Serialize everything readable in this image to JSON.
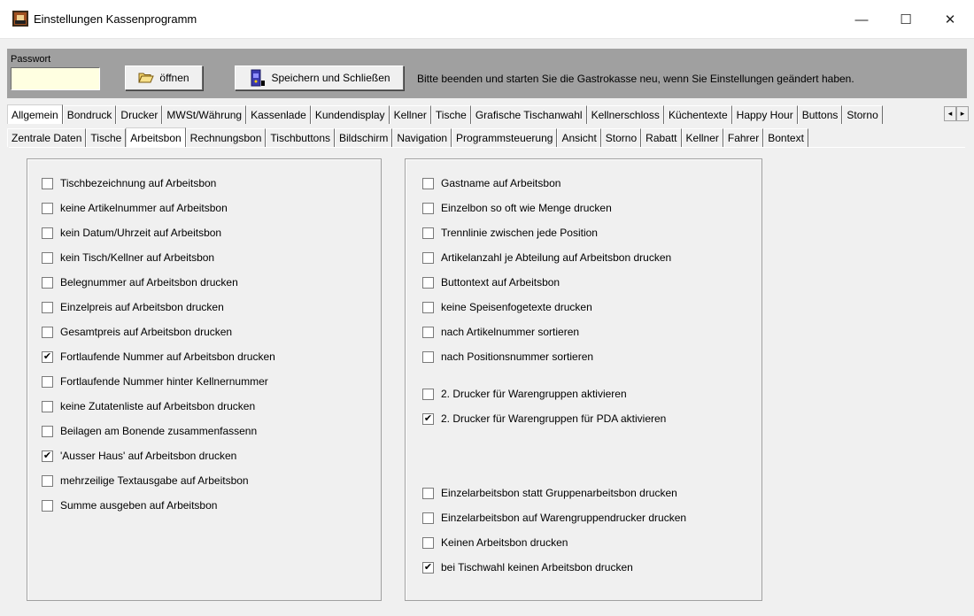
{
  "window": {
    "title": "Einstellungen Kassenprogramm",
    "controls": {
      "minimize": "—",
      "maximize": "☐",
      "close": "✕"
    }
  },
  "toolbar": {
    "password_label": "Passwort",
    "password_value": "",
    "open_label": "öffnen",
    "save_close_label": "Speichern und Schließen",
    "hint": "Bitte beenden und starten Sie die Gastrokasse neu, wenn Sie Einstellungen geändert haben."
  },
  "tabs_row1": [
    "Allgemein",
    "Bondruck",
    "Drucker",
    "MWSt/Währung",
    "Kassenlade",
    "Kundendisplay",
    "Kellner",
    "Tische",
    "Grafische Tischanwahl",
    "Kellnerschloss",
    "Küchentexte",
    "Happy Hour",
    "Buttons",
    "Storno"
  ],
  "tabs_row1_active": "Allgemein",
  "tabs_row2": [
    "Zentrale Daten",
    "Tische",
    "Arbeitsbon",
    "Rechnungsbon",
    "Tischbuttons",
    "Bildschirm",
    "Navigation",
    "Programmsteuerung",
    "Ansicht",
    "Storno",
    "Rabatt",
    "Kellner",
    "Fahrer",
    "Bontext"
  ],
  "tabs_row2_active": "Arbeitsbon",
  "left_options": [
    {
      "label": "Tischbezeichnung auf Arbeitsbon",
      "checked": false
    },
    {
      "label": "keine Artikelnummer auf Arbeitsbon",
      "checked": false
    },
    {
      "label": "kein Datum/Uhrzeit auf Arbeitsbon",
      "checked": false
    },
    {
      "label": "kein Tisch/Kellner auf Arbeitsbon",
      "checked": false
    },
    {
      "label": "Belegnummer auf Arbeitsbon drucken",
      "checked": false
    },
    {
      "label": "Einzelpreis auf Arbeitsbon drucken",
      "checked": false
    },
    {
      "label": "Gesamtpreis auf Arbeitsbon drucken",
      "checked": false
    },
    {
      "label": "Fortlaufende Nummer auf Arbeitsbon drucken",
      "checked": true
    },
    {
      "label": "Fortlaufende Nummer hinter Kellnernummer",
      "checked": false
    },
    {
      "label": "keine Zutatenliste auf Arbeitsbon drucken",
      "checked": false
    },
    {
      "label": "Beilagen am Bonende zusammenfassenn",
      "checked": false
    },
    {
      "label": "'Ausser Haus' auf Arbeitsbon drucken",
      "checked": true
    },
    {
      "label": "mehrzeilige Textausgabe auf Arbeitsbon",
      "checked": false
    },
    {
      "label": "Summe ausgeben auf Arbeitsbon",
      "checked": false
    }
  ],
  "right_options": [
    {
      "label": "Gastname auf Arbeitsbon",
      "checked": false
    },
    {
      "label": "Einzelbon so oft wie Menge drucken",
      "checked": false
    },
    {
      "label": "Trennlinie zwischen jede Position",
      "checked": false
    },
    {
      "label": "Artikelanzahl je Abteilung auf Arbeitsbon drucken",
      "checked": false
    },
    {
      "label": "Buttontext auf Arbeitsbon",
      "checked": false
    },
    {
      "label": "keine Speisenfogetexte drucken",
      "checked": false
    },
    {
      "label": "nach Artikelnummer sortieren",
      "checked": false
    },
    {
      "label": "nach Positionsnummer sortieren",
      "checked": false
    },
    {
      "label": "2. Drucker für Warengruppen  aktivieren",
      "checked": false
    },
    {
      "label": "2. Drucker für Warengruppen  für PDA aktivieren",
      "checked": true
    },
    {
      "label": "Einzelarbeitsbon statt Gruppenarbeitsbon drucken",
      "checked": false
    },
    {
      "label": "Einzelarbeitsbon auf Warengruppendrucker drucken",
      "checked": false
    },
    {
      "label": "Keinen Arbeitsbon drucken",
      "checked": false
    },
    {
      "label": "bei Tischwahl keinen Arbeitsbon drucken",
      "checked": true
    }
  ],
  "check_mark": "✔",
  "icons": {
    "app": "app-icon",
    "open": "folder-open-icon",
    "save": "save-close-icon",
    "scroll_left": "◂",
    "scroll_right": "▸"
  }
}
